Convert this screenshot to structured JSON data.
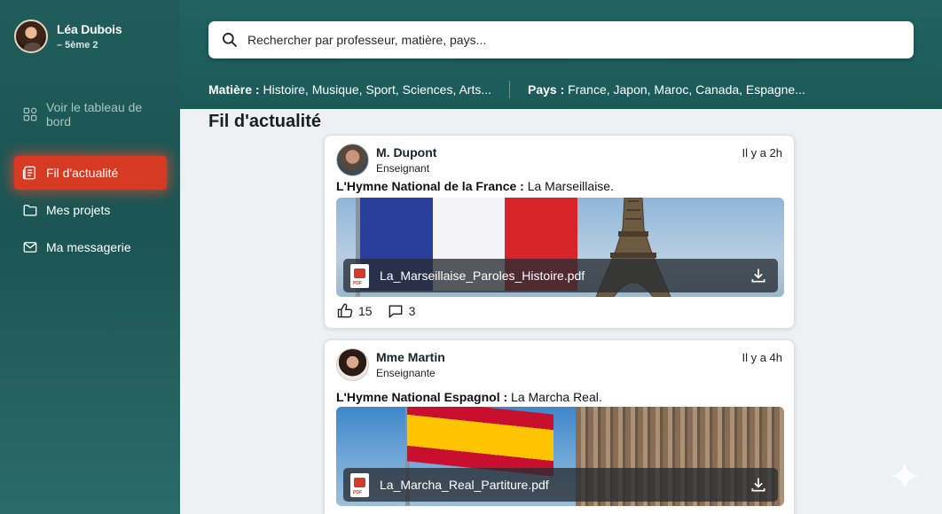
{
  "user": {
    "name": "Léa Dubois",
    "class": "– 5ème 2"
  },
  "nav": {
    "dashboard": "Voir le tableau de bord",
    "items": [
      {
        "label": "Fil d'actualité",
        "icon": "feed-icon",
        "active": true
      },
      {
        "label": "Mes projets",
        "icon": "folder-icon",
        "active": false
      },
      {
        "label": "Ma messagerie",
        "icon": "mail-icon",
        "active": false
      }
    ]
  },
  "search": {
    "placeholder": "Rechercher par professeur, matière, pays..."
  },
  "filters": {
    "subject_label": "Matière :",
    "subject_values": "Histoire, Musique, Sport, Sciences, Arts...",
    "country_label": "Pays :",
    "country_values": "France, Japon, Maroc, Canada, Espagne..."
  },
  "feed": {
    "title": "Fil d'actualité",
    "posts": [
      {
        "author": "M. Dupont",
        "role": "Enseignant",
        "time": "Il y a 2h",
        "text_bold": "L'Hymne National de la France :",
        "text": " La Marseillaise.",
        "file": "La_Marseillaise_Paroles_Histoire.pdf",
        "likes": "15",
        "comments": "3"
      },
      {
        "author": "Mme Martin",
        "role": "Enseignante",
        "time": "Il y a 4h",
        "text_bold": "L'Hymne National Espagnol :",
        "text": " La Marcha Real.",
        "file": "La_Marcha_Real_Partiture.pdf"
      }
    ]
  },
  "colors": {
    "sidebar": "#1f5c5a",
    "active": "#d63a22",
    "header": "#206361"
  }
}
